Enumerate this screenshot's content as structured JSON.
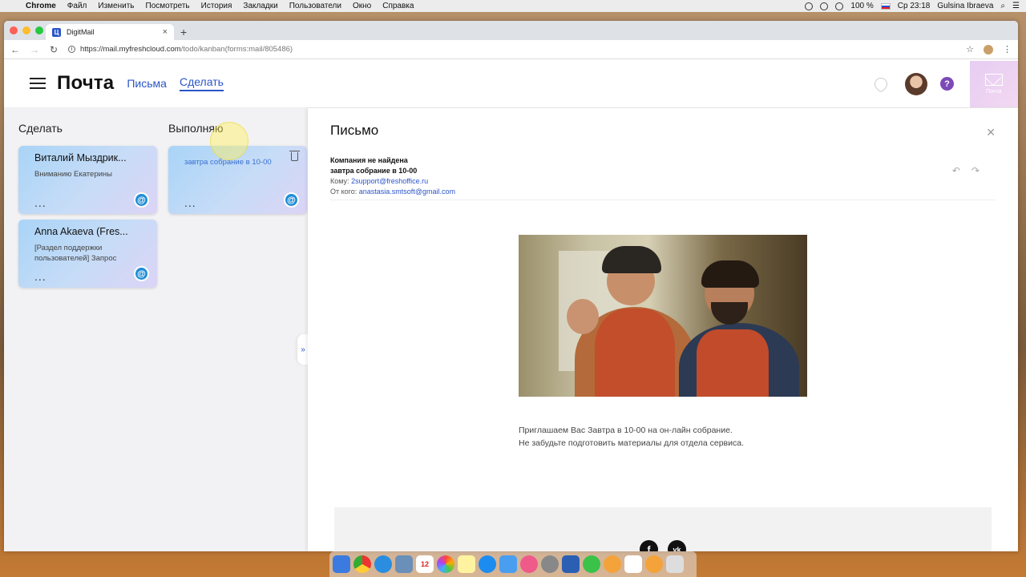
{
  "menubar": {
    "app": "Chrome",
    "items": [
      "Файл",
      "Изменить",
      "Посмотреть",
      "История",
      "Закладки",
      "Пользователи",
      "Окно",
      "Справка"
    ],
    "battery": "100 %",
    "clock": "Ср 23:18",
    "user": "Gulsina Ibraeva"
  },
  "browser": {
    "tab_title": "DigitMail",
    "favicon_letter": "Ц",
    "url_host": "https://mail.myfreshcloud.com",
    "url_path": "/todo/kanban(forms:mail/805486)"
  },
  "header": {
    "title": "Почта",
    "nav": [
      {
        "label": "Письма"
      },
      {
        "label": "Сделать"
      }
    ],
    "mail_tile_label": "Почта",
    "help_label": "?"
  },
  "kanban": {
    "columns": [
      {
        "title": "Сделать"
      },
      {
        "title": "Выполняю"
      }
    ],
    "cards": [
      {
        "title": "Виталий Мыздрик...",
        "subtitle": "Вниманию Екатерины",
        "dots": "...",
        "at": "@"
      },
      {
        "title": "Anna Akaeva (Fres...",
        "subtitle": "[Раздел поддержки пользователей] Запрос",
        "dots": "...",
        "at": "@"
      },
      {
        "subtitle": "завтра собрание в 10-00",
        "dots": "...",
        "at": "@"
      }
    ],
    "collapse_label": "»"
  },
  "mail": {
    "title": "Письмо",
    "company": "Компания не найдена",
    "subject": "завтра собрание в 10-00",
    "to_label": "Кому:",
    "to": "2support@freshoffice.ru",
    "from_label": "От кого:",
    "from": "anastasia.smtsoft@gmail.com",
    "body_line1": "Приглашаем Вас Завтра в 10-00 на он-лайн собрание.",
    "body_line2": "Не забудьте подготовить материалы для отдела сервиса.",
    "social": [
      "f",
      "vk"
    ]
  },
  "dock": {
    "calendar_day": "12"
  }
}
